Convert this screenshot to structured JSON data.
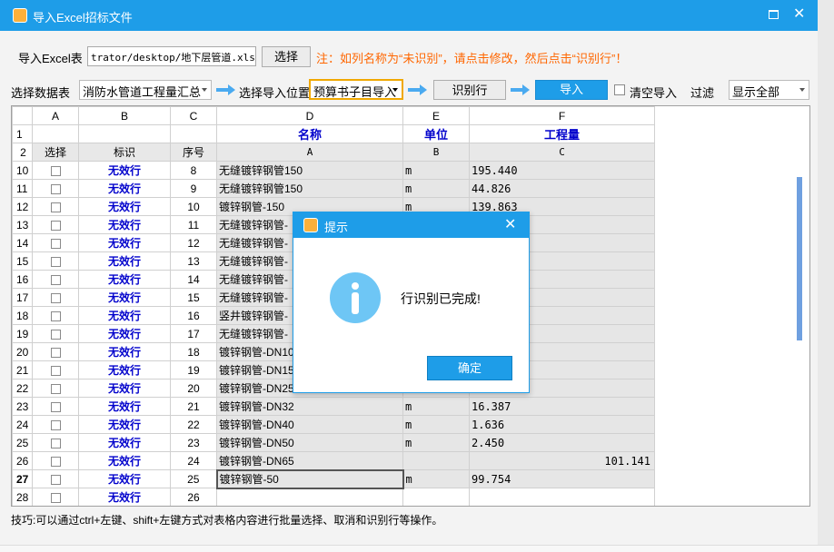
{
  "window": {
    "title": "导入Excel招标文件"
  },
  "toolbar1": {
    "import_label": "导入Excel表",
    "file_path": "trator/desktop/地下层管道.xlsx",
    "choose_button": "选择",
    "note": "注：如列名称为“未识别”，请点击修改，然后点击“识别行”！"
  },
  "toolbar2": {
    "select_sheet_label": "选择数据表",
    "sheet_value": "消防水管道工程量汇总",
    "import_pos_label": "选择导入位置",
    "import_pos_value": "预算书子目导入",
    "identify_button": "识别行",
    "import_button": "导入",
    "clear_import_label": "清空导入",
    "filter_label": "过滤",
    "filter_value": "显示全部"
  },
  "grid": {
    "columns": [
      "A",
      "B",
      "C",
      "D",
      "E",
      "F"
    ],
    "header_row1": {
      "rownum": "1",
      "D": "名称",
      "E": "单位",
      "F": "工程量"
    },
    "header_row2": {
      "rownum": "2",
      "A": "选择",
      "B": "标识",
      "C": "序号",
      "D": "A",
      "E": "B",
      "F": "C"
    },
    "rows": [
      {
        "rownum": "10",
        "ident": "无效行",
        "seq": "8",
        "name": "无缝镀锌钢管150",
        "unit": "m",
        "qty": "195.440"
      },
      {
        "rownum": "11",
        "ident": "无效行",
        "seq": "9",
        "name": "无缝镀锌钢管150",
        "unit": "m",
        "qty": "44.826"
      },
      {
        "rownum": "12",
        "ident": "无效行",
        "seq": "10",
        "name": "镀锌钢管-150",
        "unit": "m",
        "qty": "139.863"
      },
      {
        "rownum": "13",
        "ident": "无效行",
        "seq": "11",
        "name": "无缝镀锌钢管-",
        "unit": "",
        "qty": ""
      },
      {
        "rownum": "14",
        "ident": "无效行",
        "seq": "12",
        "name": "无缝镀锌钢管-",
        "unit": "",
        "qty": ""
      },
      {
        "rownum": "15",
        "ident": "无效行",
        "seq": "13",
        "name": "无缝镀锌钢管-",
        "unit": "",
        "qty": ""
      },
      {
        "rownum": "16",
        "ident": "无效行",
        "seq": "14",
        "name": "无缝镀锌钢管-",
        "unit": "",
        "qty": ""
      },
      {
        "rownum": "17",
        "ident": "无效行",
        "seq": "15",
        "name": "无缝镀锌钢管-",
        "unit": "",
        "qty": ""
      },
      {
        "rownum": "18",
        "ident": "无效行",
        "seq": "16",
        "name": "竖井镀锌钢管-",
        "unit": "",
        "qty": ""
      },
      {
        "rownum": "19",
        "ident": "无效行",
        "seq": "17",
        "name": "无缝镀锌钢管-",
        "unit": "",
        "qty": ""
      },
      {
        "rownum": "20",
        "ident": "无效行",
        "seq": "18",
        "name": "镀锌钢管-DN100",
        "unit": "",
        "qty": ""
      },
      {
        "rownum": "21",
        "ident": "无效行",
        "seq": "19",
        "name": "镀锌钢管-DN150",
        "unit": "",
        "qty": ""
      },
      {
        "rownum": "22",
        "ident": "无效行",
        "seq": "20",
        "name": "镀锌钢管-DN25",
        "unit": "",
        "qty": ""
      },
      {
        "rownum": "23",
        "ident": "无效行",
        "seq": "21",
        "name": "镀锌钢管-DN32",
        "unit": "m",
        "qty": "16.387"
      },
      {
        "rownum": "24",
        "ident": "无效行",
        "seq": "22",
        "name": "镀锌钢管-DN40",
        "unit": "m",
        "qty": "1.636"
      },
      {
        "rownum": "25",
        "ident": "无效行",
        "seq": "23",
        "name": "镀锌钢管-DN50",
        "unit": "m",
        "qty": "2.450"
      },
      {
        "rownum": "26",
        "ident": "无效行",
        "seq": "24",
        "name": "镀锌钢管-DN65",
        "unit": "",
        "qty": "101.141"
      },
      {
        "rownum": "27",
        "ident": "无效行",
        "seq": "25",
        "name": "镀锌钢管-50",
        "unit": "m",
        "qty": "99.754"
      },
      {
        "rownum": "28",
        "ident": "无效行",
        "seq": "26",
        "name": "",
        "unit": "",
        "qty": ""
      }
    ]
  },
  "tip": "技巧:可以通过ctrl+左键、shift+左键方式对表格内容进行批量选择、取消和识别行等操作。",
  "dialog": {
    "title": "提示",
    "message": "行识别已完成!",
    "ok_button": "确定"
  }
}
